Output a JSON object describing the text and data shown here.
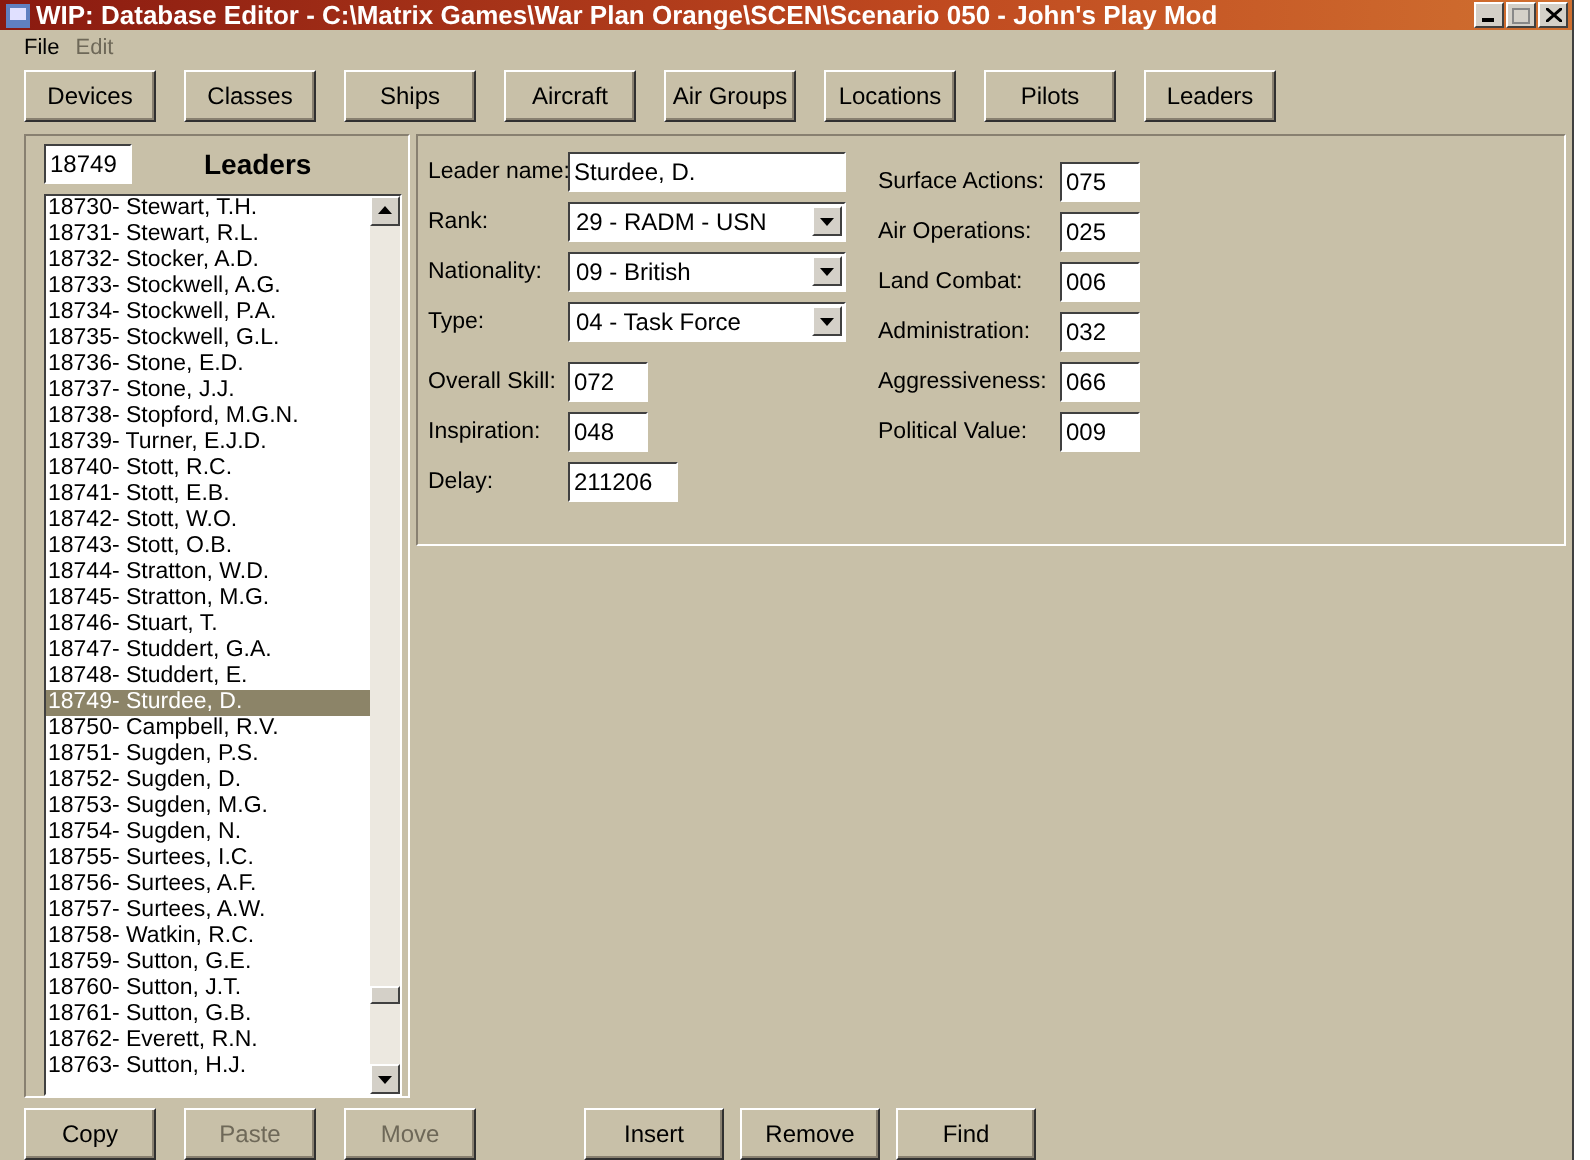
{
  "window": {
    "title": "WIP: Database Editor - C:\\Matrix Games\\War Plan Orange\\SCEN\\Scenario 050 - John's Play Mod"
  },
  "menu": [
    {
      "label": "File",
      "disabled": false
    },
    {
      "label": "Edit",
      "disabled": true
    }
  ],
  "nav_buttons": [
    "Devices",
    "Classes",
    "Ships",
    "Aircraft",
    "Air Groups",
    "Locations",
    "Pilots",
    "Leaders"
  ],
  "leaders_panel": {
    "id_value": "18749",
    "title": "Leaders",
    "items": [
      {
        "label": "18730- Stewart, T.H.",
        "selected": false
      },
      {
        "label": "18731- Stewart, R.L.",
        "selected": false
      },
      {
        "label": "18732- Stocker, A.D.",
        "selected": false
      },
      {
        "label": "18733- Stockwell, A.G.",
        "selected": false
      },
      {
        "label": "18734- Stockwell, P.A.",
        "selected": false
      },
      {
        "label": "18735- Stockwell, G.L.",
        "selected": false
      },
      {
        "label": "18736- Stone, E.D.",
        "selected": false
      },
      {
        "label": "18737- Stone, J.J.",
        "selected": false
      },
      {
        "label": "18738- Stopford, M.G.N.",
        "selected": false
      },
      {
        "label": "18739- Turner, E.J.D.",
        "selected": false
      },
      {
        "label": "18740- Stott, R.C.",
        "selected": false
      },
      {
        "label": "18741- Stott, E.B.",
        "selected": false
      },
      {
        "label": "18742- Stott, W.O.",
        "selected": false
      },
      {
        "label": "18743- Stott, O.B.",
        "selected": false
      },
      {
        "label": "18744- Stratton, W.D.",
        "selected": false
      },
      {
        "label": "18745- Stratton, M.G.",
        "selected": false
      },
      {
        "label": "18746- Stuart, T.",
        "selected": false
      },
      {
        "label": "18747- Studdert, G.A.",
        "selected": false
      },
      {
        "label": "18748- Studdert, E.",
        "selected": false
      },
      {
        "label": "18749- Sturdee, D.",
        "selected": true
      },
      {
        "label": "18750- Campbell, R.V.",
        "selected": false
      },
      {
        "label": "18751- Sugden, P.S.",
        "selected": false
      },
      {
        "label": "18752- Sugden, D.",
        "selected": false
      },
      {
        "label": "18753- Sugden, M.G.",
        "selected": false
      },
      {
        "label": "18754- Sugden, N.",
        "selected": false
      },
      {
        "label": "18755- Surtees, I.C.",
        "selected": false
      },
      {
        "label": "18756- Surtees, A.F.",
        "selected": false
      },
      {
        "label": "18757- Surtees, A.W.",
        "selected": false
      },
      {
        "label": "18758- Watkin, R.C.",
        "selected": false
      },
      {
        "label": "18759- Sutton, G.E.",
        "selected": false
      },
      {
        "label": "18760- Sutton, J.T.",
        "selected": false
      },
      {
        "label": "18761- Sutton, G.B.",
        "selected": false
      },
      {
        "label": "18762- Everett, R.N.",
        "selected": false
      },
      {
        "label": "18763- Sutton, H.J.",
        "selected": false
      }
    ]
  },
  "form": {
    "left": [
      {
        "kind": "text",
        "label": "Leader name:",
        "value": "Sturdee, D."
      },
      {
        "kind": "dropdown",
        "label": "Rank:",
        "value": "29 - RADM - USN"
      },
      {
        "kind": "dropdown",
        "label": "Nationality:",
        "value": "09 - British"
      },
      {
        "kind": "dropdown",
        "label": "Type:",
        "value": "04 - Task Force"
      },
      {
        "kind": "short",
        "label": "Overall Skill:",
        "value": "072"
      },
      {
        "kind": "short",
        "label": "Inspiration:",
        "value": "048"
      },
      {
        "kind": "medium",
        "label": "Delay:",
        "value": "211206"
      }
    ],
    "right": [
      {
        "label": "Surface Actions:",
        "value": "075"
      },
      {
        "label": "Air Operations:",
        "value": "025"
      },
      {
        "label": "Land Combat:",
        "value": "006"
      },
      {
        "label": "Administration:",
        "value": "032"
      },
      {
        "label": "Aggressiveness:",
        "value": "066"
      },
      {
        "label": "Political Value:",
        "value": "009"
      }
    ]
  },
  "clipboard_buttons": [
    {
      "label": "Copy",
      "disabled": false
    },
    {
      "label": "Paste",
      "disabled": true
    },
    {
      "label": "Move",
      "disabled": true
    }
  ],
  "record_buttons": [
    {
      "label": "Insert",
      "disabled": false
    },
    {
      "label": "Remove",
      "disabled": false
    },
    {
      "label": "Find",
      "disabled": false
    }
  ]
}
